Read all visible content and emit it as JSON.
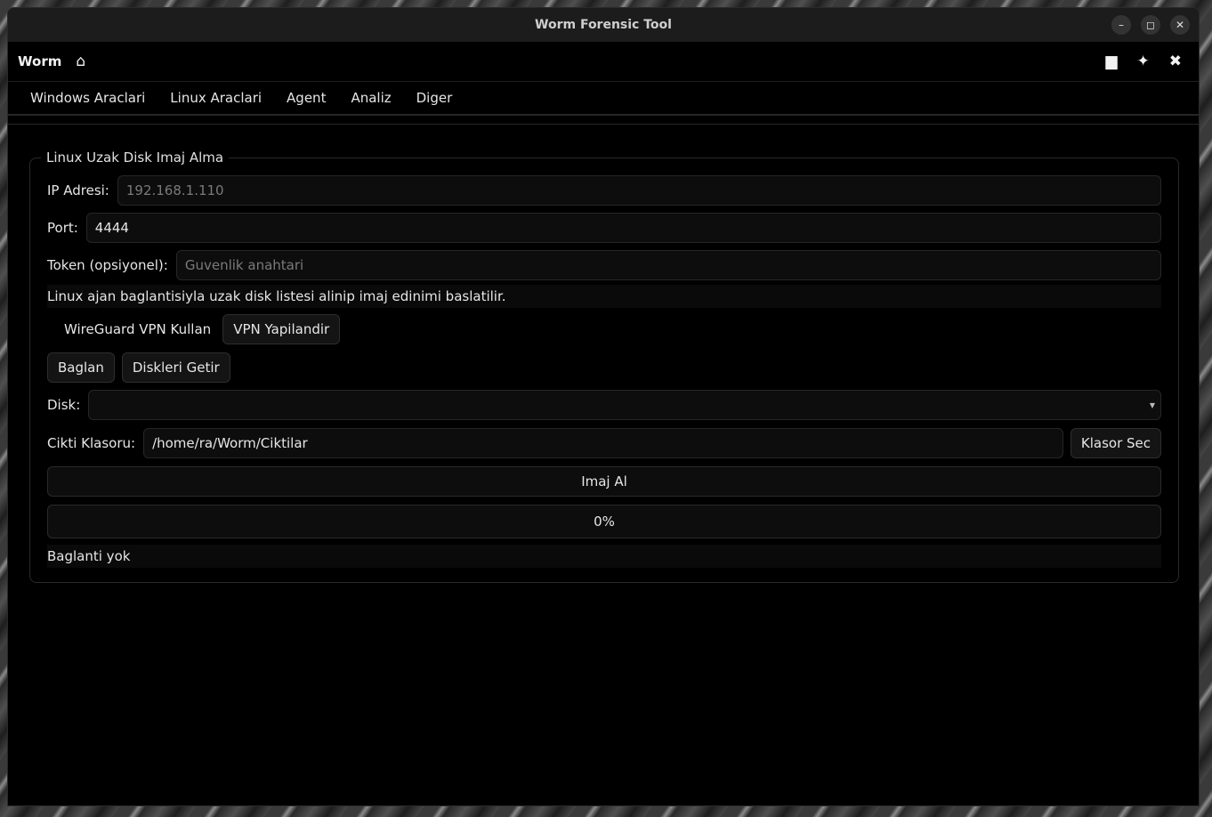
{
  "window": {
    "title": "Worm Forensic Tool"
  },
  "appbar": {
    "brand": "Worm"
  },
  "menu": [
    "Windows Araclari",
    "Linux Araclari",
    "Agent",
    "Analiz",
    "Diger"
  ],
  "group": {
    "title": "Linux Uzak Disk Imaj Alma",
    "ip": {
      "label": "IP Adresi:",
      "placeholder": "192.168.1.110"
    },
    "port": {
      "label": "Port:",
      "value": "4444"
    },
    "token": {
      "label": "Token (opsiyonel):",
      "placeholder": "Guvenlik anahtari"
    },
    "info": "Linux ajan baglantisiyla uzak disk listesi alinip imaj edinimi baslatilir.",
    "vpn_check_label": "WireGuard VPN Kullan",
    "vpn_config_label": "VPN Yapilandir",
    "connect_label": "Baglan",
    "fetch_disks_label": "Diskleri Getir",
    "disk": {
      "label": "Disk:",
      "value": ""
    },
    "output": {
      "label": "Cikti Klasoru:",
      "value": "/home/ra/Worm/Ciktilar",
      "browse_label": "Klasor Sec"
    },
    "image_button_label": "Imaj Al",
    "progress": {
      "percent": 0,
      "text": "0%"
    },
    "status": "Baglanti yok"
  }
}
